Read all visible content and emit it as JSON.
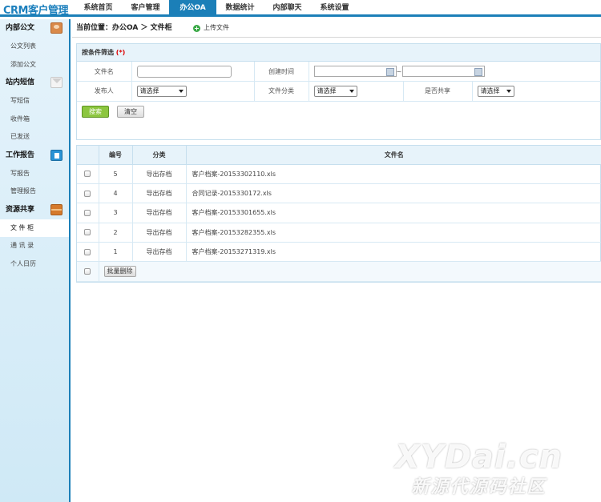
{
  "app": {
    "logo": "CRM客户管理"
  },
  "nav": [
    "系统首页",
    "客户管理",
    "办公OA",
    "数据统计",
    "内部聊天",
    "系统设置"
  ],
  "sidebar": {
    "sections": [
      {
        "title": "内部公文",
        "icon": "document-mail-icon",
        "items": [
          "公文列表",
          "添加公文"
        ]
      },
      {
        "title": "站内短信",
        "icon": "envelope-icon",
        "items": [
          "写短信",
          "收件箱",
          "已发送"
        ]
      },
      {
        "title": "工作报告",
        "icon": "report-icon",
        "items": [
          "写报告",
          "管理报告"
        ]
      },
      {
        "title": "资源共享",
        "icon": "archive-box-icon",
        "items": [
          "文 件 柜",
          "通 讯 录",
          "个人日历"
        ]
      }
    ],
    "active_item": "文 件 柜"
  },
  "breadcrumb": "当前位置：办公OA ＞ 文件柜",
  "upload_label": "上传文件",
  "filter": {
    "title": "按条件筛选",
    "required_mark": "(*)",
    "filename_label": "文件名",
    "created_label": "创建时间",
    "tilde": "~",
    "publisher_label": "发布人",
    "publisher_value": "请选择",
    "category_label": "文件分类",
    "category_value": "请选择",
    "shared_label": "是否共享",
    "shared_value": "请选择",
    "search_button": "搜索",
    "clear_button": "清空"
  },
  "table": {
    "headers": [
      "编号",
      "分类",
      "文件名"
    ],
    "rows": [
      {
        "id": "5",
        "category": "导出存档",
        "filename": "客户档案-20153302110.xls"
      },
      {
        "id": "4",
        "category": "导出存档",
        "filename": "合同记录-2015330172.xls"
      },
      {
        "id": "3",
        "category": "导出存档",
        "filename": "客户档案-20153301655.xls"
      },
      {
        "id": "2",
        "category": "导出存档",
        "filename": "客户档案-20153282355.xls"
      },
      {
        "id": "1",
        "category": "导出存档",
        "filename": "客户档案-20153271319.xls"
      }
    ],
    "batch_delete": "批量删除"
  },
  "watermark": {
    "line1": "XYDai.cn",
    "line2": "新源代源码社区"
  }
}
